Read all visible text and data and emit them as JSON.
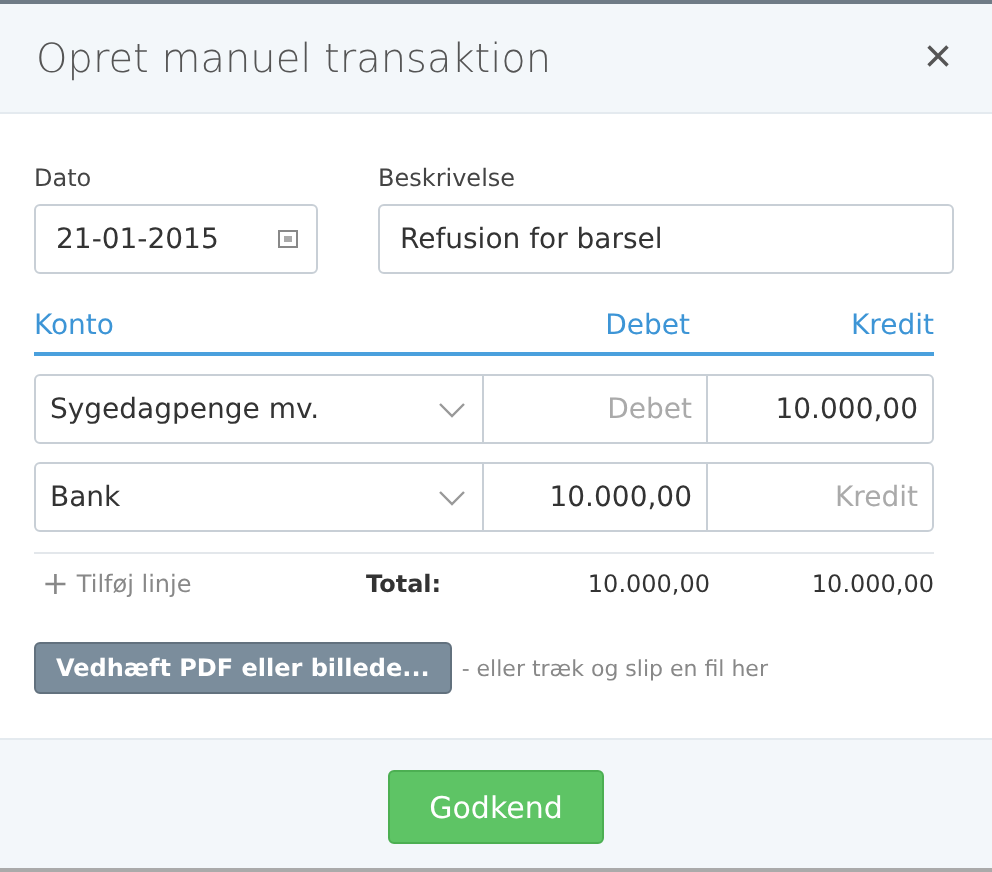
{
  "dialog": {
    "title": "Opret manuel transaktion",
    "close": "×"
  },
  "date": {
    "label": "Dato",
    "value": "21-01-2015"
  },
  "description": {
    "label": "Beskrivelse",
    "value": "Refusion for barsel"
  },
  "columns": {
    "account": "Konto",
    "debit": "Debet",
    "credit": "Kredit"
  },
  "lines": [
    {
      "account": "Sygedagpenge mv.",
      "debit": {
        "placeholder": "Debet"
      },
      "credit": {
        "value": "10.000,00"
      }
    },
    {
      "account": "Bank",
      "debit": {
        "value": "10.000,00"
      },
      "credit": {
        "placeholder": "Kredit"
      }
    }
  ],
  "add_line": {
    "icon": "+",
    "label": "Tilføj linje"
  },
  "total": {
    "label": "Total:",
    "debit": "10.000,00",
    "credit": "10.000,00"
  },
  "attach": {
    "button": "Vedhæft PDF eller billede...",
    "hint": "- eller træk og slip en fil her"
  },
  "approve_button": "Godkend"
}
